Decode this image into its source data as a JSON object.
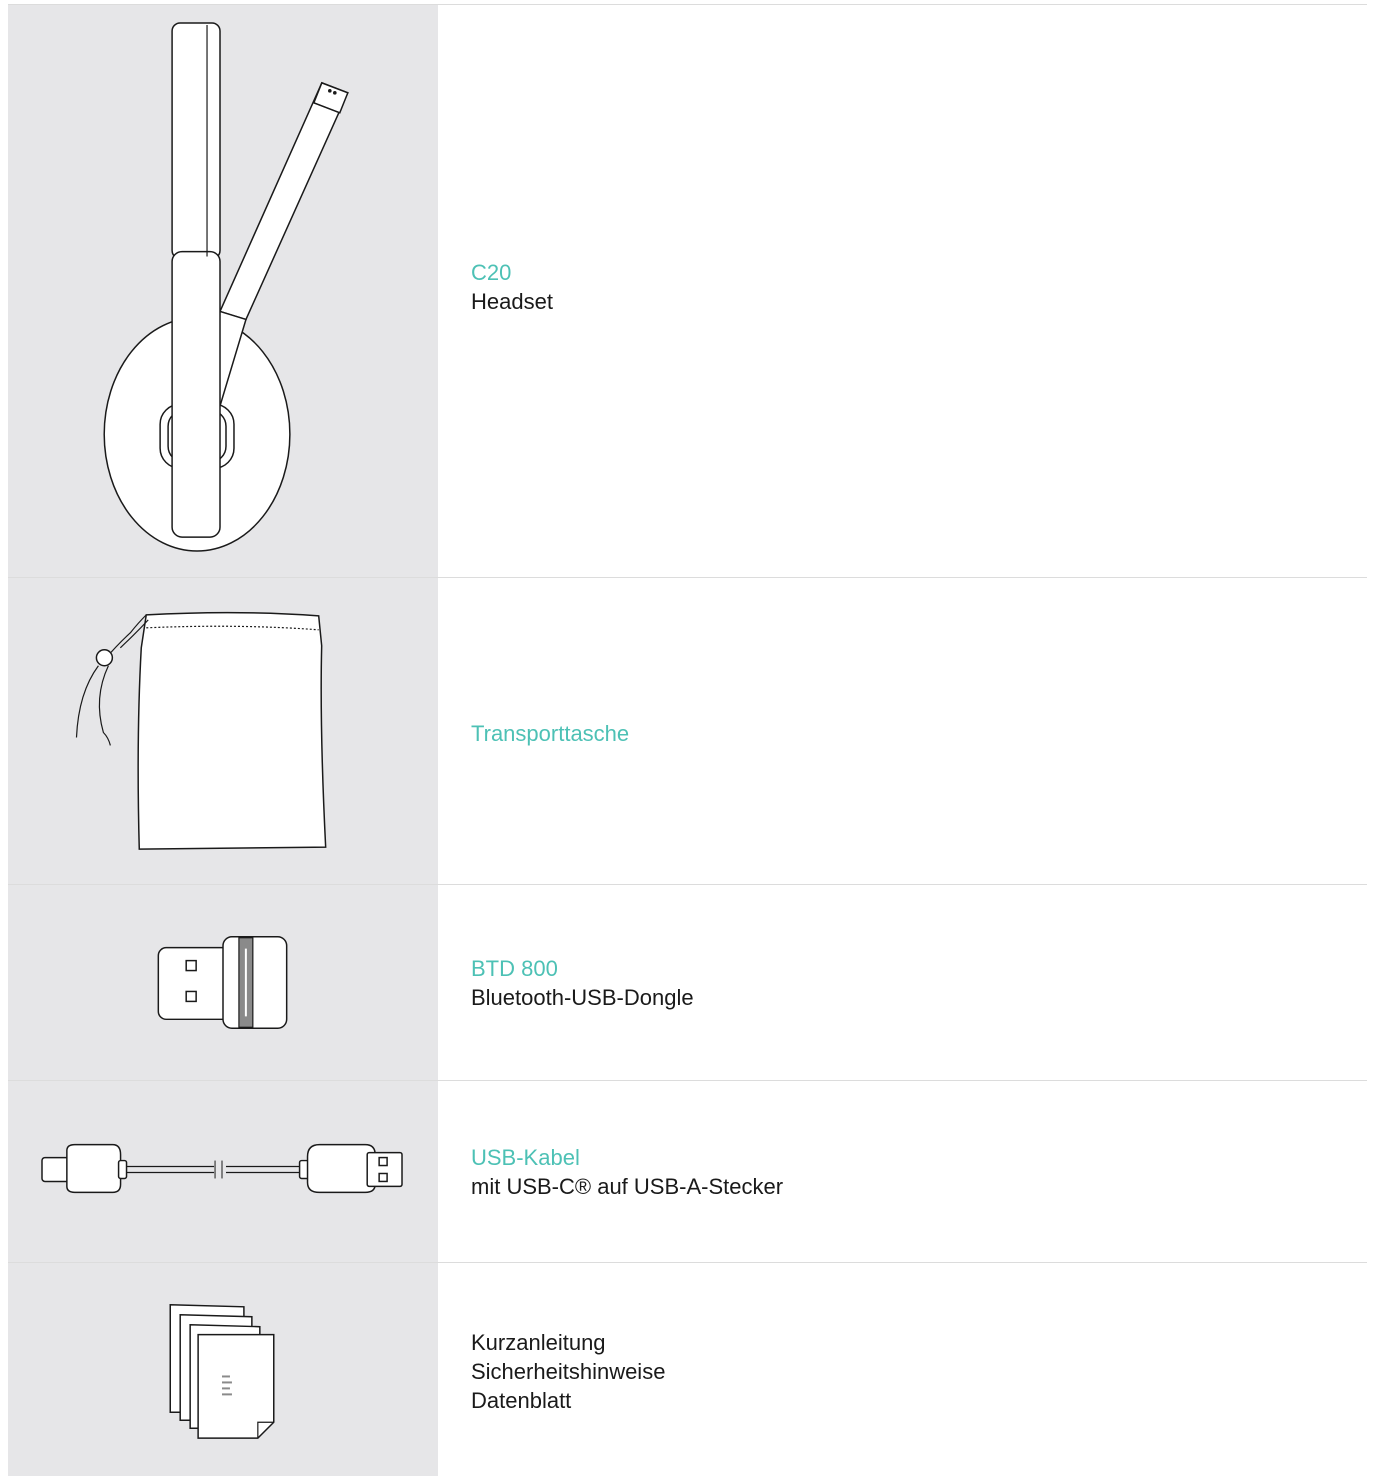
{
  "items": [
    {
      "icon": "headset-illustration",
      "title": "C20",
      "lines": [
        "Headset"
      ]
    },
    {
      "icon": "pouch-illustration",
      "title": "Transporttasche",
      "lines": []
    },
    {
      "icon": "usb-dongle-illustration",
      "title": "BTD 800",
      "lines": [
        "Bluetooth-USB-Dongle"
      ]
    },
    {
      "icon": "usb-cable-illustration",
      "title": "USB-Kabel",
      "lines": [
        "mit USB-C® auf USB-A-Stecker"
      ]
    },
    {
      "icon": "documents-illustration",
      "title": "",
      "lines": [
        "Kurzanleitung",
        "Sicherheitshinweise",
        "Datenblatt"
      ]
    }
  ],
  "colors": {
    "accent": "#4dc1b5",
    "image_bg": "#e6e6e8",
    "divider": "#dcdcdc"
  }
}
